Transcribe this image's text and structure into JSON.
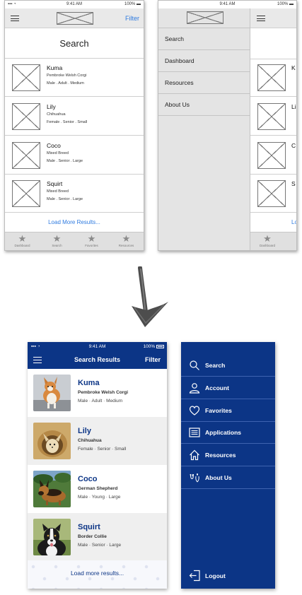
{
  "wireframe_list": {
    "status": {
      "signal": "▪▪▪ ◔",
      "time": "9:41 AM",
      "battery": "100% ▬"
    },
    "filter_label": "Filter",
    "title": "Search",
    "results": [
      {
        "name": "Kuma",
        "breed": "Pembroke Welsh Corgi",
        "details": "Male . Adult . Medium"
      },
      {
        "name": "Lily",
        "breed": "Chihuahua",
        "details": "Female . Senior . Small"
      },
      {
        "name": "Coco",
        "breed": "Mixed Breed",
        "details": "Male . Senior . Large"
      },
      {
        "name": "Squirt",
        "breed": "Mixed Breed",
        "details": "Male . Senior . Large"
      }
    ],
    "load_more": "Load More Results...",
    "tabs": [
      {
        "icon": "star-icon",
        "label": "Dashboard"
      },
      {
        "icon": "star-icon",
        "label": "Search"
      },
      {
        "icon": "star-icon",
        "label": "Favorites"
      },
      {
        "icon": "star-icon",
        "label": "Resources"
      }
    ]
  },
  "wireframe_menu": {
    "status": {
      "time": "9:41 AM",
      "battery": "100% ▬"
    },
    "items": [
      "Search",
      "Dashboard",
      "Resources",
      "About Us"
    ],
    "peek_initials": [
      "K",
      "Li",
      "C",
      "S"
    ],
    "peek_load": "Lo",
    "peek_tab": "Dashboard"
  },
  "hifi_list": {
    "status": {
      "signal": "▪▪▪ ◔",
      "time": "9:41 AM",
      "battery": "100%"
    },
    "title": "Search Results",
    "filter_label": "Filter",
    "results": [
      {
        "name": "Kuma",
        "breed": "Pembroke Welsh Corgi",
        "details": "Male · Adult · Medium"
      },
      {
        "name": "Lily",
        "breed": "Chihuahua",
        "details": "Female · Senior · Small"
      },
      {
        "name": "Coco",
        "breed": "German Shepherd",
        "details": "Male · Young · Large"
      },
      {
        "name": "Squirt",
        "breed": "Border Collie",
        "details": "Male · Senior · Large"
      }
    ],
    "load_more": "Load more results..."
  },
  "hifi_menu": {
    "items": [
      {
        "icon": "search-icon",
        "label": "Search"
      },
      {
        "icon": "account-icon",
        "label": "Account"
      },
      {
        "icon": "heart-icon",
        "label": "Favorites"
      },
      {
        "icon": "applications-icon",
        "label": "Applications"
      },
      {
        "icon": "home-icon",
        "label": "Resources"
      },
      {
        "icon": "pets-icon",
        "label": "About Us"
      }
    ],
    "logout": {
      "icon": "logout-icon",
      "label": "Logout"
    }
  },
  "colors": {
    "brand_blue": "#0c3586",
    "wire_link_blue": "#2f7be0",
    "row_alt": "#efefef"
  }
}
